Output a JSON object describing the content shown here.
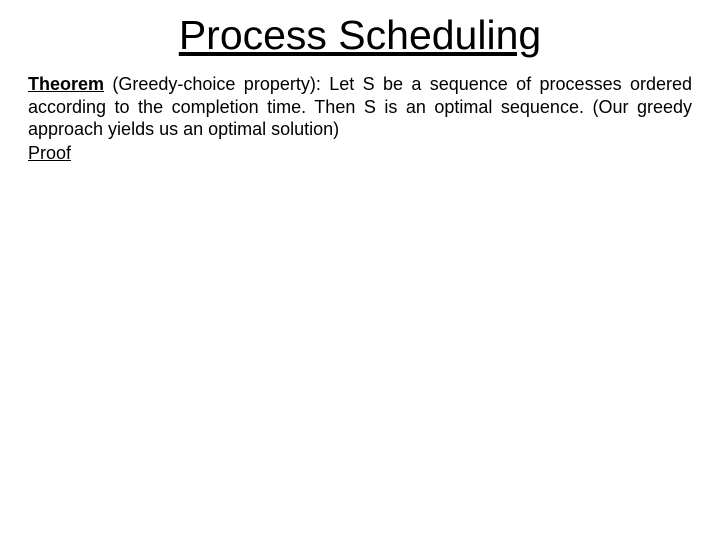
{
  "slide": {
    "title": "Process Scheduling",
    "theorem_label": "Theorem",
    "theorem_text": " (Greedy-choice property): Let S be a sequence of processes ordered according to the completion time. Then S is an optimal sequence. (Our greedy approach yields us an optimal solution)",
    "proof_label": "Proof"
  }
}
